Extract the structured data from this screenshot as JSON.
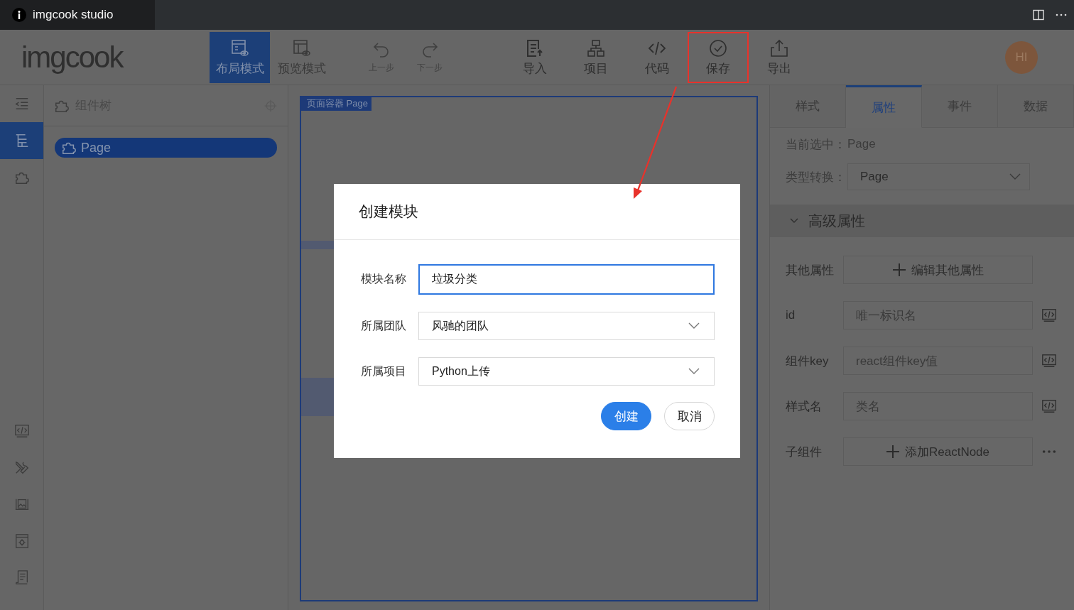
{
  "window": {
    "title": "imgcook studio"
  },
  "toolbar": {
    "logo": "imgcook",
    "modes": [
      {
        "label": "布局模式",
        "kind": "layout",
        "selected": true
      },
      {
        "label": "预览模式",
        "kind": "preview",
        "selected": false
      }
    ],
    "history": [
      {
        "label": "上一步",
        "kind": "undo",
        "disabled": true
      },
      {
        "label": "下一步",
        "kind": "redo",
        "disabled": true
      }
    ],
    "actions": [
      {
        "label": "导入",
        "kind": "import",
        "highlighted": false
      },
      {
        "label": "项目",
        "kind": "project",
        "highlighted": false
      },
      {
        "label": "代码",
        "kind": "code",
        "highlighted": false
      },
      {
        "label": "保存",
        "kind": "save",
        "highlighted": true
      },
      {
        "label": "导出",
        "kind": "export",
        "highlighted": false
      }
    ],
    "avatar": "HI"
  },
  "left_rail": {
    "top": [
      {
        "kind": "outline",
        "selected": false
      },
      {
        "kind": "tree",
        "selected": true
      },
      {
        "kind": "puzzle",
        "selected": false
      }
    ],
    "bottom": [
      {
        "kind": "code",
        "selected": false
      },
      {
        "kind": "tools",
        "selected": false
      },
      {
        "kind": "image",
        "selected": false
      },
      {
        "kind": "settings",
        "selected": false
      },
      {
        "kind": "doc",
        "selected": false
      }
    ]
  },
  "component_tree": {
    "title": "组件树",
    "nodes": [
      {
        "label": "Page",
        "selected": true
      }
    ]
  },
  "canvas": {
    "label": "页面容器 Page"
  },
  "dialog": {
    "title": "创建模块",
    "fields": [
      {
        "label": "模块名称",
        "kind": "input",
        "value": "垃圾分类",
        "focused": true
      },
      {
        "label": "所属团队",
        "kind": "select",
        "value": "风驰的团队",
        "focused": false
      },
      {
        "label": "所属项目",
        "kind": "select",
        "value": "Python上传",
        "focused": false
      }
    ],
    "buttons": [
      {
        "label": "创建",
        "primary": true
      },
      {
        "label": "取消",
        "primary": false
      }
    ]
  },
  "inspector": {
    "tabs": [
      {
        "label": "样式",
        "selected": false
      },
      {
        "label": "属性",
        "selected": true
      },
      {
        "label": "事件",
        "selected": false
      },
      {
        "label": "数据",
        "selected": false
      }
    ],
    "current_label": "当前选中：",
    "current_value": "Page",
    "type_label": "类型转换：",
    "type_value": "Page",
    "section": {
      "title": "高级属性",
      "expanded": true
    },
    "props": [
      {
        "label": "其他属性",
        "kind": "button",
        "text": "编辑其他属性",
        "has_code": false,
        "has_more": false
      },
      {
        "label": "id",
        "kind": "input",
        "placeholder": "唯一标识名",
        "has_code": true,
        "has_more": false
      },
      {
        "label": "组件key",
        "kind": "input",
        "placeholder": "react组件key值",
        "has_code": true,
        "has_more": false
      },
      {
        "label": "样式名",
        "kind": "input",
        "placeholder": "类名",
        "has_code": true,
        "has_more": false
      },
      {
        "label": "子组件",
        "kind": "button",
        "text": "添加ReactNode",
        "has_code": false,
        "has_more": true
      }
    ]
  }
}
